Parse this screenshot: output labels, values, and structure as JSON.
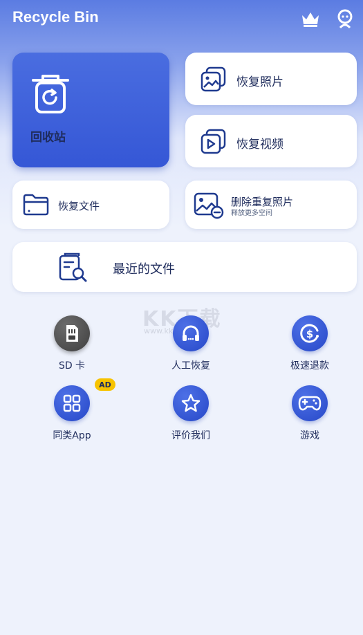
{
  "header": {
    "title": "Recycle Bin",
    "icons": [
      "crown-icon",
      "avatar-icon"
    ]
  },
  "cards": {
    "recycle_bin": "回收站",
    "restore_photos": "恢复照片",
    "restore_videos": "恢复视频",
    "restore_files": "恢复文件",
    "remove_duplicates": "删除重复照片",
    "remove_duplicates_sub": "释放更多空间",
    "recent_files": "最近的文件"
  },
  "grid": [
    {
      "label": "SD 卡",
      "icon": "sd-card-icon"
    },
    {
      "label": "人工恢复",
      "icon": "headphones-icon"
    },
    {
      "label": "极速退款",
      "icon": "refund-icon"
    },
    {
      "label": "同类App",
      "icon": "apps-icon",
      "badge": "AD"
    },
    {
      "label": "评价我们",
      "icon": "star-icon"
    },
    {
      "label": "游戏",
      "icon": "gamepad-icon"
    }
  ],
  "watermark": "KK下载",
  "watermark_url": "www.kkx.net",
  "colors": {
    "primary": "#3557d6",
    "text": "#1f2c5c",
    "badge": "#f7c300"
  }
}
